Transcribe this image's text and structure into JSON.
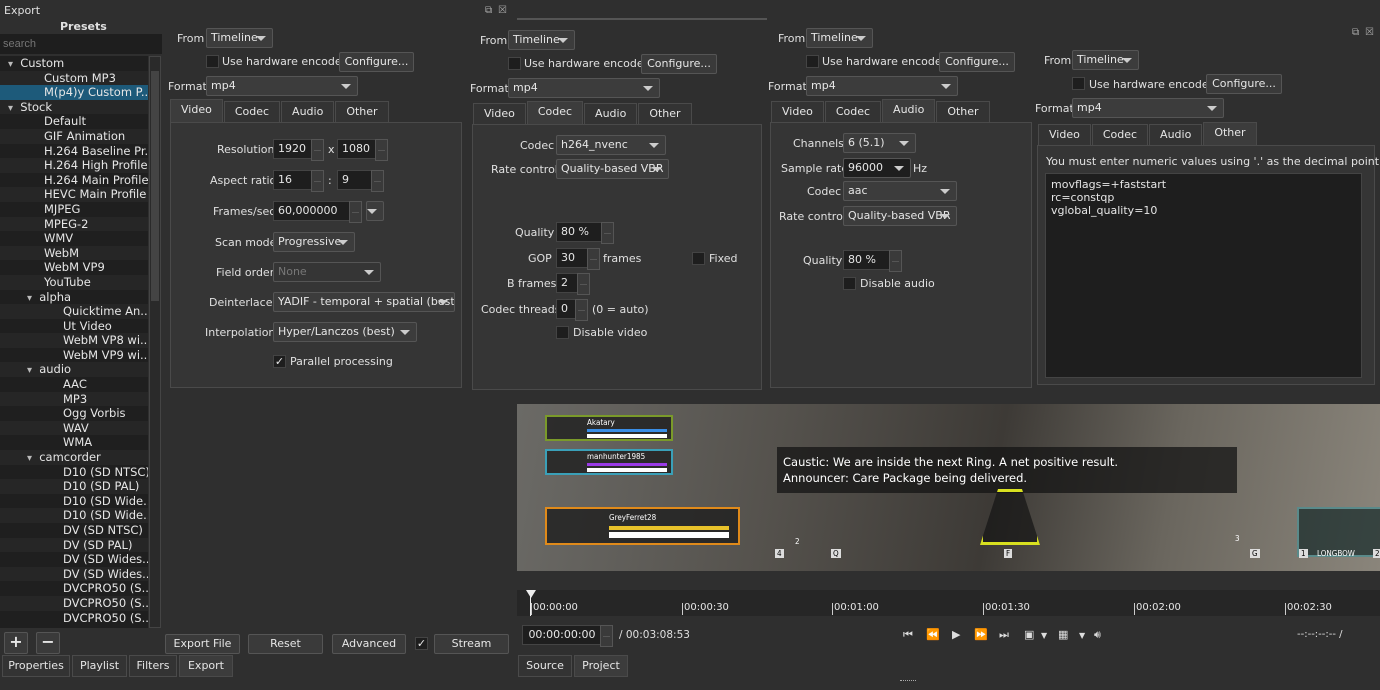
{
  "dock": {
    "title": "Export",
    "presets_heading": "Presets",
    "search_placeholder": "search"
  },
  "presets": [
    {
      "label": "Custom",
      "level": 0,
      "group": true
    },
    {
      "label": "Custom MP3",
      "level": 1
    },
    {
      "label": "M(p4)y Custom P...",
      "level": 1,
      "selected": true
    },
    {
      "label": "Stock",
      "level": 0,
      "group": true
    },
    {
      "label": "Default",
      "level": 1
    },
    {
      "label": "GIF Animation",
      "level": 1
    },
    {
      "label": "H.264 Baseline Pr...",
      "level": 1
    },
    {
      "label": "H.264 High Profile",
      "level": 1
    },
    {
      "label": "H.264 Main Profile",
      "level": 1
    },
    {
      "label": "HEVC Main Profile",
      "level": 1
    },
    {
      "label": "MJPEG",
      "level": 1
    },
    {
      "label": "MPEG-2",
      "level": 1
    },
    {
      "label": "WMV",
      "level": 1
    },
    {
      "label": "WebM",
      "level": 1
    },
    {
      "label": "WebM VP9",
      "level": 1
    },
    {
      "label": "YouTube",
      "level": 1
    },
    {
      "label": "alpha",
      "level": 1,
      "group": true
    },
    {
      "label": "Quicktime An...",
      "level": 2
    },
    {
      "label": "Ut Video",
      "level": 2
    },
    {
      "label": "WebM VP8 wi...",
      "level": 2
    },
    {
      "label": "WebM VP9 wi...",
      "level": 2
    },
    {
      "label": "audio",
      "level": 1,
      "group": true
    },
    {
      "label": "AAC",
      "level": 2
    },
    {
      "label": "MP3",
      "level": 2
    },
    {
      "label": "Ogg Vorbis",
      "level": 2
    },
    {
      "label": "WAV",
      "level": 2
    },
    {
      "label": "WMA",
      "level": 2
    },
    {
      "label": "camcorder",
      "level": 1,
      "group": true
    },
    {
      "label": "D10 (SD NTSC)",
      "level": 2
    },
    {
      "label": "D10 (SD PAL)",
      "level": 2
    },
    {
      "label": "D10 (SD Wide...",
      "level": 2
    },
    {
      "label": "D10 (SD Wide...",
      "level": 2
    },
    {
      "label": "DV (SD NTSC)",
      "level": 2
    },
    {
      "label": "DV (SD PAL)",
      "level": 2
    },
    {
      "label": "DV (SD Wides...",
      "level": 2
    },
    {
      "label": "DV (SD Wides...",
      "level": 2
    },
    {
      "label": "DVCPRO50 (S...",
      "level": 2
    },
    {
      "label": "DVCPRO50 (S...",
      "level": 2
    },
    {
      "label": "DVCPRO50 (S...",
      "level": 2
    }
  ],
  "common": {
    "from_label": "From",
    "from_value": "Timeline",
    "hw_label": "Use hardware encoder",
    "configure": "Configure...",
    "format_label": "Format",
    "format_value": "mp4",
    "tabs": [
      "Video",
      "Codec",
      "Audio",
      "Other"
    ]
  },
  "video": {
    "resolution_label": "Resolution",
    "width": "1920",
    "x": "x",
    "height": "1080",
    "aspect_label": "Aspect ratio",
    "aspect_w": "16",
    "colon": ":",
    "aspect_h": "9",
    "fps_label": "Frames/sec",
    "fps": "60,000000",
    "scan_label": "Scan mode",
    "scan": "Progressive",
    "field_label": "Field order",
    "field": "None",
    "deint_label": "Deinterlacer",
    "deint": "YADIF - temporal + spatial (best)",
    "interp_label": "Interpolation",
    "interp": "Hyper/Lanczos (best)",
    "parallel_label": "Parallel processing",
    "parallel": true
  },
  "codec": {
    "codec_label": "Codec",
    "codec": "h264_nvenc",
    "rate_label": "Rate control",
    "rate": "Quality-based VBR",
    "quality_label": "Quality",
    "quality": "80 %",
    "gop_label": "GOP",
    "gop": "30",
    "gop_unit": "frames",
    "fixed_label": "Fixed",
    "bframes_label": "B frames",
    "bframes": "2",
    "threads_label": "Codec threads",
    "threads": "0",
    "threads_hint": "(0 = auto)",
    "disable_label": "Disable video"
  },
  "audio": {
    "channels_label": "Channels",
    "channels": "6 (5.1)",
    "rate_label": "Sample rate",
    "rate": "96000",
    "hz": "Hz",
    "codec_label": "Codec",
    "codec": "aac",
    "rc_label": "Rate control",
    "rc": "Quality-based VBR",
    "quality_label": "Quality",
    "quality": "80 %",
    "disable_label": "Disable audio"
  },
  "other": {
    "note": "You must enter numeric values using '.' as the decimal point.",
    "options": "movflags=+faststart\nrc=constqp\nvglobal_quality=10"
  },
  "actions": {
    "export_file": "Export File",
    "reset": "Reset",
    "advanced": "Advanced",
    "stream": "Stream"
  },
  "bottom_tabs": [
    "Properties",
    "Playlist",
    "Filters",
    "Export"
  ],
  "preview": {
    "subtitle1": "Caustic: We are inside the next Ring. A net positive result.",
    "subtitle2": "Announcer: Care Package being delivered.",
    "player1": "Akatary",
    "player2": "manhunter1985",
    "player3": "GreyFerret28",
    "key_4": "4",
    "key_q": "Q",
    "key_f": "F",
    "key_g": "G",
    "ammo_2": "2",
    "ammo_3": "3",
    "slot_1": "1",
    "weapon": "LONGBOW",
    "slot_2": "2"
  },
  "timeline": {
    "ticks": [
      "00:00:00",
      "00:00:30",
      "00:01:00",
      "00:01:30",
      "00:02:00",
      "00:02:30"
    ],
    "position": "00:00:00:00",
    "duration": "/ 00:03:08:53",
    "inout": "--:--:--:-- /"
  },
  "player_tabs": [
    "Source",
    "Project"
  ],
  "colors": {
    "selection": "#1d5a7a",
    "bg": "#2f2f2f"
  }
}
